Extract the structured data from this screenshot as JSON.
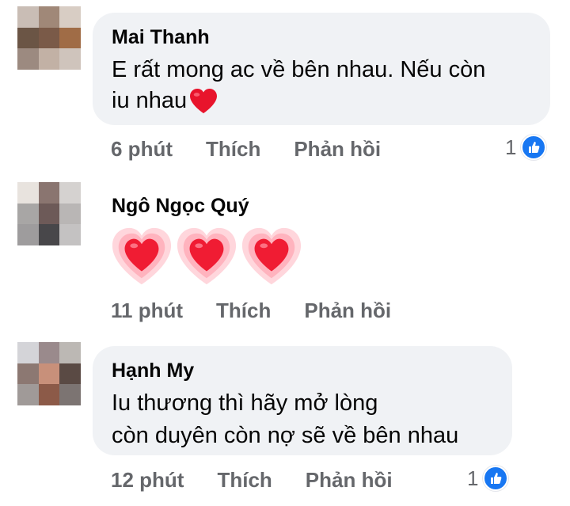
{
  "comments": [
    {
      "author": "Mai Thanh",
      "text_line1": "E rất mong ac về bên nhau. Nếu còn",
      "text_line2": "iu nhau",
      "time": "6 phút",
      "like": "Thích",
      "reply": "Phản hồi",
      "like_count": "1",
      "trailing_icon": "red-heart-icon",
      "avatar_colors": [
        "#c9bdb5",
        "#a08878",
        "#d8cdc4",
        "#6b5545",
        "#7a5a48",
        "#a06c46",
        "#9c8a80",
        "#c2b1a5",
        "#cfc4bc"
      ]
    },
    {
      "author": "Ngô Ngọc Quý",
      "emoji_count": 3,
      "emoji_icon": "heart-emoji-icon",
      "time": "11 phút",
      "like": "Thích",
      "reply": "Phản hồi",
      "avatar_colors": [
        "#e8e3de",
        "#8a7570",
        "#d5d2d0",
        "#a8a6a5",
        "#6d5a58",
        "#b9b6b5",
        "#9e9c9d",
        "#48474a",
        "#c4c2c2"
      ]
    },
    {
      "author": "Hạnh My",
      "text_line1": "Iu thương thì hãy mở lòng",
      "text_line2": "còn duyên còn nợ sẽ về bên nhau",
      "time": "12 phút",
      "like": "Thích",
      "reply": "Phản hồi",
      "like_count": "1",
      "avatar_colors": [
        "#d4d4d8",
        "#9a8a8c",
        "#bcb8b4",
        "#8c7872",
        "#c8907a",
        "#5a4a44",
        "#a09a98",
        "#8c5a48",
        "#7c7472"
      ]
    }
  ],
  "colors": {
    "bubble_bg": "#f0f2f5",
    "meta_text": "#65676b",
    "like_blue": "#1877f2",
    "heart_red": "#e8142c"
  }
}
